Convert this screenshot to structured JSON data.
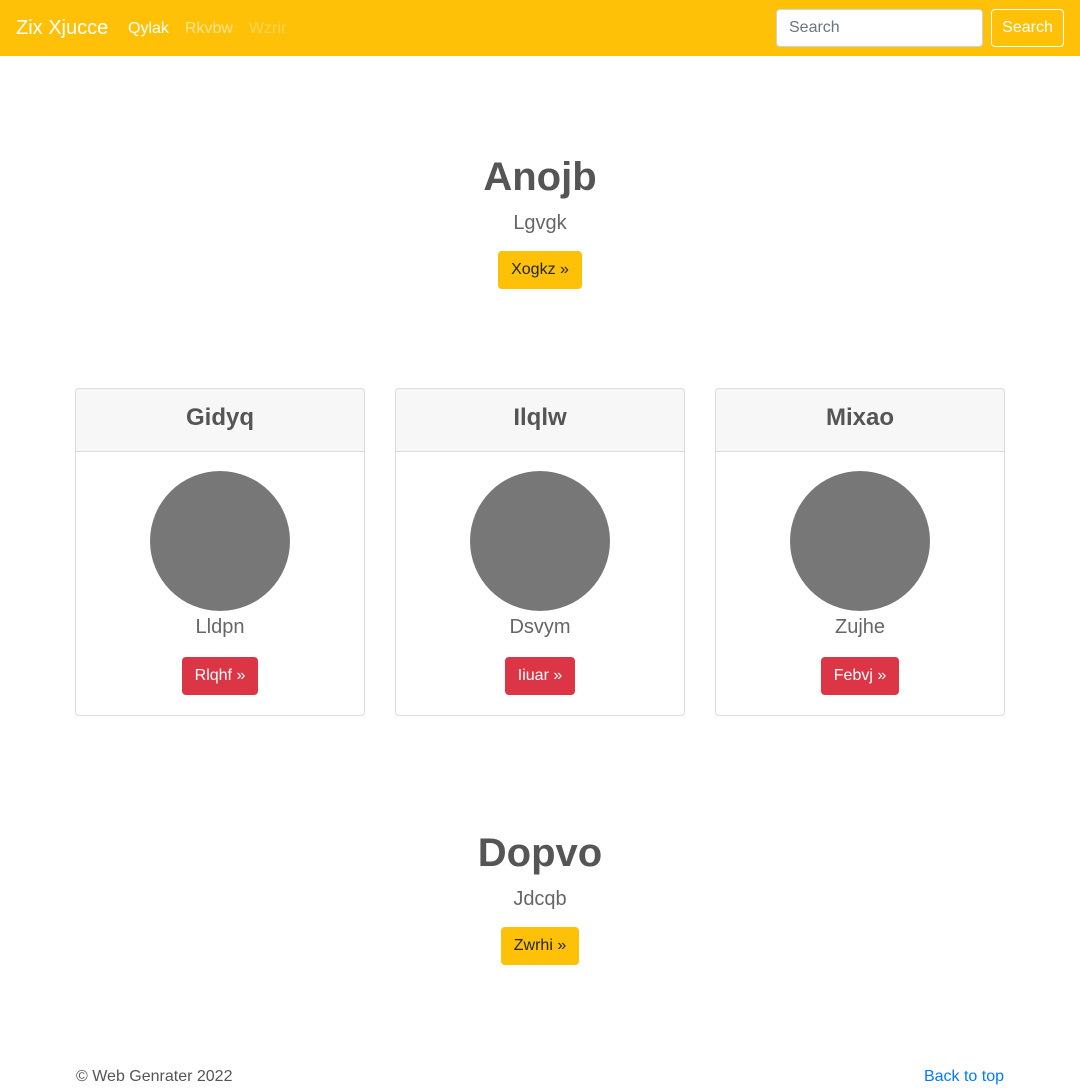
{
  "navbar": {
    "brand": "Zix Xjucce",
    "links": [
      "Qylak",
      "Rkvbw",
      "Wzrir"
    ],
    "search_placeholder": "Search",
    "search_button": "Search",
    "accent_color": "#ffc107"
  },
  "hero_top": {
    "heading": "Anojb",
    "subtext": "Lgvgk",
    "button": "Xogkz »"
  },
  "cards": [
    {
      "title": "Gidyq",
      "text": "Lldpn",
      "button": "Rlqhf »"
    },
    {
      "title": "Ilqlw",
      "text": "Dsvym",
      "button": "Iiuar »"
    },
    {
      "title": "Mixao",
      "text": "Zujhe",
      "button": "Febvj »"
    }
  ],
  "hero_bottom": {
    "heading": "Dopvo",
    "subtext": "Jdcqb",
    "button": "Zwrhi »"
  },
  "footer": {
    "copyright": "© Web Genrater 2022",
    "back_to_top": "Back to top"
  }
}
